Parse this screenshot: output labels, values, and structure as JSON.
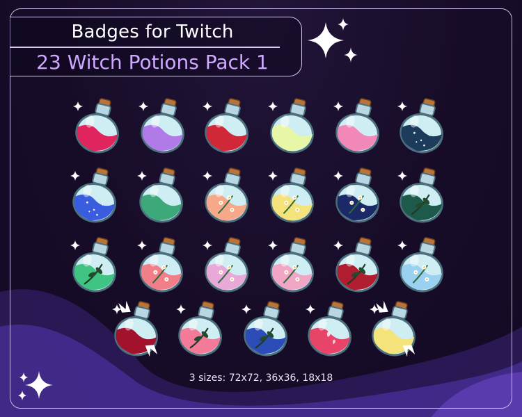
{
  "header": {
    "title": "Badges for Twitch",
    "subtitle": "23 Witch Potions Pack 1"
  },
  "footer": {
    "sizes_text": "3 sizes: 72x72, 36x36, 18x18"
  },
  "colors": {
    "background": "#170c28",
    "frame": "#c8b6e8",
    "subtitle": "#cfa9ff",
    "wave": "#4a2f9a"
  },
  "badges": [
    {
      "liquid": "#e0245e",
      "deco": "none"
    },
    {
      "liquid": "#b07ae8",
      "deco": "none"
    },
    {
      "liquid": "#d02838",
      "deco": "none"
    },
    {
      "liquid": "#e6f7a8",
      "deco": "none"
    },
    {
      "liquid": "#f288b8",
      "deco": "none"
    },
    {
      "liquid": "#1d3b5a",
      "deco": "stars"
    },
    {
      "liquid": "#3a5de0",
      "deco": "stars"
    },
    {
      "liquid": "#3da87a",
      "deco": "none"
    },
    {
      "liquid": "#f5a98a",
      "deco": "flowers"
    },
    {
      "liquid": "#f4e27a",
      "deco": "flowers"
    },
    {
      "liquid": "#1b2a66",
      "deco": "flowers"
    },
    {
      "liquid": "#1d5a4a",
      "deco": "leaf"
    },
    {
      "liquid": "#3fc483",
      "deco": "leaf"
    },
    {
      "liquid": "#f27e8a",
      "deco": "flowers"
    },
    {
      "liquid": "#e8a8d8",
      "deco": "flowers"
    },
    {
      "liquid": "#f2a6c6",
      "deco": "flowers"
    },
    {
      "liquid": "#b01c30",
      "deco": "leaf"
    },
    {
      "liquid": "#9ad0f0",
      "deco": "flowers"
    },
    {
      "liquid": "#a3122c",
      "deco": "wings"
    },
    {
      "liquid": "#f47a9a",
      "deco": "leaf"
    },
    {
      "liquid": "#2c4db8",
      "deco": "leaf"
    },
    {
      "liquid": "#e8446a",
      "deco": "hearts"
    },
    {
      "liquid": "#f4e27a",
      "deco": "wings"
    }
  ]
}
